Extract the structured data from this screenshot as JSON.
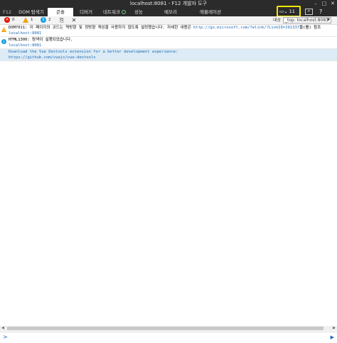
{
  "window": {
    "title": "localhost:8081 - F12 개발자 도구"
  },
  "tabs": [
    {
      "label": "F12"
    },
    {
      "label": "DOM 탐색기"
    },
    {
      "label": "콘솔"
    },
    {
      "label": "디버거"
    },
    {
      "label": "네트워크"
    },
    {
      "label": "성능"
    },
    {
      "label": "메모리"
    },
    {
      "label": "에뮬레이션"
    }
  ],
  "emulation": {
    "count": "11"
  },
  "toolbar": {
    "error_count": "0",
    "warning_count": "1",
    "info_count": "2",
    "target_label": "대상",
    "target_value": "_top: localhost:8081"
  },
  "messages": [
    {
      "type": "warning",
      "text": "DOM7011: 이 페이지의 코드는 역방향 및 정방향 캐싱을 사용하지 않도록 설정했습니다. 자세한 내용은 ",
      "link": "http://go.microsoft.com/fwlink/?LinkID=291337",
      "suffix": "을(를) 참조",
      "source": "localhost:8081"
    },
    {
      "type": "info",
      "text": "HTML1300: 탐색이 실행되었습니다.",
      "source": "localhost:8081"
    },
    {
      "type": "log",
      "text": "Download the Vue Devtools extension for a better development experience:",
      "link": "https://github.com/vuejs/vue-devtools"
    }
  ],
  "colors": {
    "error": "#e51400",
    "warning": "#f0a30a",
    "info": "#1ba1e2",
    "highlight": "#f2e600"
  }
}
